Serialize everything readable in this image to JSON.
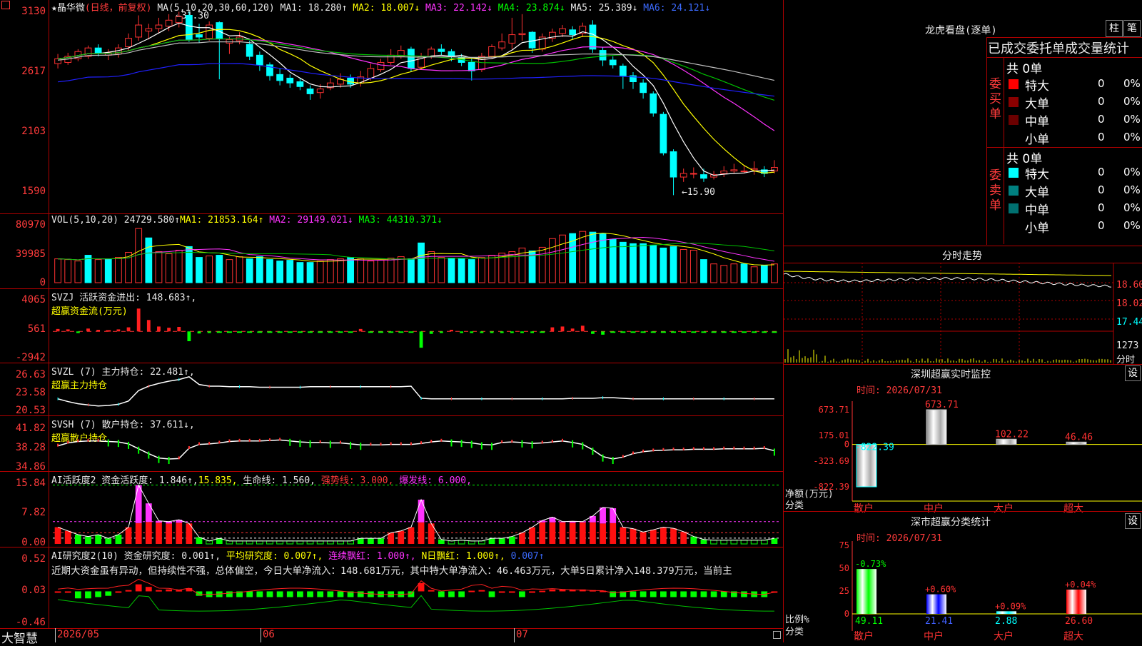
{
  "kline": {
    "title_star": "★晶华微",
    "title_mode": "(日线，前复权)",
    "ma_prefix": "MA(5,10,20,30,60,120)",
    "ma1": "MA1: 18.280↑",
    "ma2": "MA2: 18.007↓",
    "ma3": "MA3: 22.142↓",
    "ma4": "MA4: 23.874↓",
    "ma5": "MA5: 25.389↓",
    "ma6": "MA6: 24.121↓",
    "high_mark": "31.30",
    "low_mark": "←15.90",
    "y_labels": [
      "3130",
      "2617",
      "2103",
      "1590"
    ]
  },
  "vol": {
    "prefix": "VOL(5,10,20)",
    "value": "24729.580↑",
    "ma1": "MA1: 21853.164↑",
    "ma2": "MA2: 29149.021↓",
    "ma3": "MA3: 44310.371↓",
    "y_labels": [
      "80970",
      "39985",
      "0"
    ]
  },
  "svzj": {
    "line1": "SVZJ  活跃资金进出: 148.683↑,",
    "line2": "超赢资金流(万元)",
    "y_labels": [
      "4065",
      "561",
      "-2942"
    ]
  },
  "svzl": {
    "line1": "SVZL (7) 主力持仓: 22.481↑,",
    "line2": "超赢主力持仓",
    "y_labels": [
      "26.63",
      "23.58",
      "20.53"
    ]
  },
  "svsh": {
    "line1": "SVSH (7) 散户持仓: 37.611↓,",
    "line2": "超赢散户持仓",
    "y_labels": [
      "41.82",
      "38.28",
      "34.86"
    ]
  },
  "ai1": {
    "prefix": "AI活跃度2 资金活跃度: 1.846↑,",
    "v2": "15.835,",
    "life": "生命线: 1.560,",
    "strong": "强势线: 3.000,",
    "burst": "爆发线: 6.000,",
    "y_labels": [
      "15.84",
      "7.82",
      "0.00"
    ]
  },
  "ai2": {
    "prefix": "AI研究度2(10) 资金研究度: 0.001↑,",
    "avg": "平均研究度: 0.007↑,",
    "lianxu": "连续飘红: 1.000↑,",
    "nday": "N日飘红: 1.000↑,",
    "last": "0.007↑",
    "commentary": "近期大资金虽有异动，但持续性不强，总体偏空，今日大单净流入：148.681万元，其中特大单净流入：46.463万元，大单5日累计净入148.379万元，当前主",
    "y_labels": [
      "0.52",
      "0.03",
      "-0.46"
    ]
  },
  "bottom": {
    "logo": "大智慧",
    "dates": [
      "2026/05",
      "06",
      "07"
    ]
  },
  "lhb": {
    "title": "龙虎看盘(逐单)",
    "btn1": "柱",
    "btn2": "笔",
    "header": "已成交委托单成交量统计",
    "buy_total": "共 0单",
    "buy_side": "委买单",
    "sell_total": "共 0单",
    "sell_side": "委卖单",
    "buy_rows": [
      {
        "name": "特大",
        "num": "0",
        "pct": "0%",
        "color": "#ff0000"
      },
      {
        "name": "大单",
        "num": "0",
        "pct": "0%",
        "color": "#8b0000"
      },
      {
        "name": "中单",
        "num": "0",
        "pct": "0%",
        "color": "#6b0000"
      },
      {
        "name": "小单",
        "num": "0",
        "pct": "0%",
        "color": "#000000"
      }
    ],
    "sell_rows": [
      {
        "name": "特大",
        "num": "0",
        "pct": "0%",
        "color": "#00ffff"
      },
      {
        "name": "大单",
        "num": "0",
        "pct": "0%",
        "color": "#008080"
      },
      {
        "name": "中单",
        "num": "0",
        "pct": "0%",
        "color": "#007070"
      },
      {
        "name": "小单",
        "num": "0",
        "pct": "0%",
        "color": "#000000"
      }
    ]
  },
  "fenshi": {
    "title": "分时走势",
    "y_labels": [
      "18.60",
      "18.02",
      "17.44",
      "1273"
    ],
    "footer": "分时"
  },
  "szmon": {
    "title": "深圳超赢实时监控",
    "btn": "设",
    "time": "时间: 2026/07/31",
    "y_labels": [
      "673.71",
      "175.01",
      "0",
      "-323.69",
      "-822.39"
    ],
    "axis_title1": "净额(万元)",
    "axis_title2": "分类",
    "cats": [
      "散户",
      "中户",
      "大户",
      "超大"
    ],
    "values": [
      -822.39,
      673.71,
      102.22,
      46.46
    ],
    "value_labels": [
      "-822.39",
      "673.71",
      "102.22",
      "46.46"
    ]
  },
  "szcls": {
    "title": "深市超赢分类统计",
    "btn": "设",
    "time": "时间: 2026/07/31",
    "y_labels": [
      "75",
      "50",
      "25",
      "0"
    ],
    "axis_title1": "比例%",
    "axis_title2": "分类",
    "cats": [
      "散户",
      "中户",
      "大户",
      "超大"
    ],
    "values": [
      49.11,
      21.41,
      2.88,
      26.6
    ],
    "value_labels": [
      "49.11",
      "21.41",
      "2.88",
      "26.60"
    ],
    "changes": [
      "-0.73%",
      "+0.60%",
      "+0.09%",
      "+0.04%"
    ],
    "colors": [
      "#00ff00",
      "#0000ff",
      "#00ffff",
      "#ff0000"
    ]
  },
  "chart_data": [
    {
      "type": "candlestick",
      "name": "price-kline",
      "ylim": [
        15.0,
        31.8
      ],
      "candles": [
        [
          27.0,
          27.4,
          26.6,
          27.8
        ],
        [
          27.1,
          27.6,
          26.9,
          27.9
        ],
        [
          27.4,
          28.0,
          27.2,
          28.2
        ],
        [
          27.6,
          28.3,
          27.4,
          28.5
        ],
        [
          28.3,
          27.9,
          27.6,
          28.6
        ],
        [
          27.7,
          27.9,
          27.3,
          28.2
        ],
        [
          27.8,
          28.3,
          27.5,
          28.6
        ],
        [
          28.4,
          29.1,
          28.1,
          29.5
        ],
        [
          29.2,
          30.2,
          28.9,
          31.0
        ],
        [
          29.7,
          29.9,
          29.0,
          30.3
        ],
        [
          29.9,
          30.2,
          29.5,
          30.8
        ],
        [
          30.1,
          30.6,
          29.7,
          31.1
        ],
        [
          30.4,
          30.9,
          30.0,
          31.3
        ],
        [
          31.0,
          29.0,
          28.8,
          31.3
        ],
        [
          29.4,
          29.2,
          28.7,
          30.3
        ],
        [
          29.1,
          30.2,
          28.9,
          30.5
        ],
        [
          30.4,
          29.1,
          25.7,
          30.5
        ],
        [
          28.7,
          29.0,
          27.8,
          29.2
        ],
        [
          28.9,
          29.2,
          28.6,
          29.6
        ],
        [
          28.6,
          27.6,
          27.3,
          28.9
        ],
        [
          27.7,
          26.9,
          26.4,
          28.0
        ],
        [
          26.9,
          26.0,
          25.6,
          27.1
        ],
        [
          26.1,
          25.6,
          25.2,
          26.6
        ],
        [
          25.8,
          25.4,
          25.0,
          26.1
        ],
        [
          25.5,
          25.1,
          24.8,
          25.8
        ],
        [
          24.9,
          24.5,
          24.0,
          25.2
        ],
        [
          24.6,
          24.9,
          24.1,
          25.3
        ],
        [
          25.0,
          25.4,
          24.8,
          25.8
        ],
        [
          25.3,
          25.7,
          25.0,
          26.2
        ],
        [
          25.8,
          25.3,
          25.0,
          26.1
        ],
        [
          25.4,
          25.9,
          25.1,
          26.4
        ],
        [
          25.8,
          26.6,
          25.6,
          27.0
        ],
        [
          26.5,
          27.1,
          26.3,
          27.4
        ],
        [
          27.1,
          27.7,
          26.9,
          28.2
        ],
        [
          27.6,
          28.1,
          27.4,
          28.5
        ],
        [
          28.2,
          26.6,
          26.3,
          28.4
        ],
        [
          26.7,
          27.6,
          26.5,
          27.9
        ],
        [
          27.6,
          28.2,
          27.4,
          28.4
        ],
        [
          28.2,
          28.0,
          27.7,
          28.6
        ],
        [
          28.0,
          27.6,
          27.2,
          28.2
        ],
        [
          27.5,
          27.1,
          26.8,
          27.8
        ],
        [
          27.1,
          26.4,
          25.6,
          27.4
        ],
        [
          26.5,
          27.6,
          26.3,
          27.9
        ],
        [
          27.6,
          28.4,
          27.4,
          28.6
        ],
        [
          28.3,
          28.8,
          28.1,
          29.5
        ],
        [
          28.7,
          29.4,
          28.2,
          30.8
        ],
        [
          29.4,
          29.5,
          28.9,
          31.1
        ],
        [
          29.6,
          28.3,
          27.9,
          29.7
        ],
        [
          28.2,
          29.2,
          28.0,
          29.5
        ],
        [
          29.1,
          29.6,
          28.8,
          29.9
        ],
        [
          29.5,
          29.9,
          29.2,
          30.2
        ],
        [
          29.8,
          29.4,
          29.0,
          30.1
        ],
        [
          29.5,
          30.1,
          29.2,
          30.4
        ],
        [
          30.2,
          28.2,
          27.9,
          30.6
        ],
        [
          28.1,
          27.3,
          26.8,
          28.4
        ],
        [
          27.3,
          26.9,
          26.6,
          27.6
        ],
        [
          26.8,
          26.0,
          24.9,
          27.0
        ],
        [
          26.0,
          25.5,
          24.9,
          26.3
        ],
        [
          25.4,
          24.6,
          24.1,
          25.7
        ],
        [
          24.5,
          22.9,
          22.6,
          24.7
        ],
        [
          22.8,
          19.6,
          19.4,
          23.0
        ],
        [
          19.7,
          17.6,
          16.1,
          19.9
        ],
        [
          17.6,
          17.9,
          17.2,
          18.3
        ],
        [
          17.9,
          17.9,
          17.5,
          18.4
        ],
        [
          17.8,
          17.5,
          17.2,
          18.3
        ],
        [
          17.6,
          17.8,
          17.4,
          18.1
        ],
        [
          17.9,
          18.1,
          17.6,
          18.5
        ],
        [
          18.1,
          18.2,
          17.9,
          18.7
        ],
        [
          18.1,
          18.1,
          17.9,
          18.6
        ],
        [
          18.2,
          18.3,
          17.8,
          18.9
        ],
        [
          18.2,
          17.9,
          17.6,
          18.5
        ],
        [
          18.1,
          18.4,
          17.9,
          19.0
        ]
      ]
    },
    {
      "type": "bar",
      "name": "volume",
      "ylim": [
        0,
        85000
      ],
      "values": [
        33000,
        32000,
        30000,
        38000,
        32000,
        33000,
        35000,
        42000,
        75000,
        62000,
        43000,
        40000,
        45000,
        50000,
        35000,
        37000,
        38000,
        32000,
        36000,
        33000,
        36000,
        32000,
        30000,
        31000,
        28000,
        28000,
        30000,
        32000,
        33000,
        35000,
        33000,
        30000,
        31000,
        34000,
        36000,
        33000,
        55000,
        43000,
        35000,
        34000,
        33000,
        32000,
        35000,
        38000,
        41000,
        43000,
        48000,
        44000,
        49000,
        61000,
        66000,
        68000,
        71000,
        70000,
        68000,
        60000,
        56000,
        54000,
        54000,
        52000,
        48000,
        50000,
        46000,
        45000,
        32000,
        26000,
        24000,
        26000,
        26000,
        22000,
        24000,
        26000
      ],
      "up": [
        1,
        1,
        1,
        0,
        1,
        0,
        1,
        1,
        1,
        0,
        1,
        1,
        1,
        0,
        0,
        1,
        0,
        1,
        1,
        0,
        0,
        0,
        0,
        0,
        0,
        0,
        1,
        1,
        1,
        0,
        1,
        1,
        1,
        1,
        1,
        0,
        0,
        1,
        1,
        0,
        0,
        0,
        1,
        1,
        1,
        1,
        1,
        0,
        1,
        1,
        1,
        0,
        1,
        0,
        0,
        0,
        0,
        0,
        0,
        0,
        0,
        0,
        1,
        1,
        0,
        1,
        1,
        1,
        0,
        1,
        0,
        1
      ]
    },
    {
      "type": "bar",
      "name": "svzj-fund-flow",
      "ylim": [
        -3300,
        4400
      ],
      "values": [
        300,
        250,
        -200,
        350,
        200,
        150,
        250,
        500,
        2800,
        1400,
        600,
        450,
        550,
        -1200,
        -250,
        -200,
        -150,
        -150,
        -150,
        -150,
        -150,
        -150,
        -150,
        -150,
        -150,
        -150,
        -150,
        -150,
        -150,
        -150,
        300,
        -150,
        -150,
        -150,
        -150,
        -150,
        -2000,
        -300,
        -200,
        200,
        -200,
        -200,
        -200,
        -200,
        -200,
        -200,
        -200,
        -200,
        -150,
        500,
        600,
        350,
        700,
        -300,
        -400,
        -150,
        -150,
        -150,
        -150,
        -150,
        -150,
        -150,
        -150,
        -150,
        -150,
        -150,
        -150,
        -150,
        -150,
        -150,
        -150,
        -150
      ]
    },
    {
      "type": "line",
      "name": "svzl-main-holding",
      "ylim": [
        20.0,
        27.0
      ],
      "values": [
        22.5,
        22.0,
        21.6,
        21.4,
        21.2,
        21.3,
        21.5,
        22.1,
        24.0,
        24.8,
        25.3,
        25.7,
        26.0,
        26.5,
        25.1,
        24.8,
        24.8,
        24.7,
        24.7,
        24.7,
        24.6,
        24.6,
        24.6,
        24.6,
        24.6,
        24.7,
        24.7,
        24.7,
        24.7,
        24.7,
        24.7,
        24.7,
        24.7,
        24.7,
        24.7,
        24.8,
        22.6,
        22.5,
        22.5,
        22.5,
        22.5,
        22.5,
        22.5,
        22.5,
        22.5,
        22.5,
        22.5,
        22.5,
        22.5,
        22.5,
        22.5,
        22.6,
        22.6,
        22.6,
        22.7,
        22.7,
        22.6,
        22.5,
        22.5,
        22.5,
        22.5,
        22.5,
        22.5,
        22.5,
        22.5,
        22.5,
        22.5,
        22.5,
        22.5,
        22.5,
        22.5,
        22.5
      ]
    },
    {
      "type": "line",
      "name": "svsh-retail-holding",
      "ylim": [
        34.0,
        42.5
      ],
      "values": [
        38.6,
        39.2,
        39.5,
        39.6,
        39.6,
        39.5,
        39.4,
        39.0,
        38.0,
        37.0,
        36.1,
        35.9,
        36.0,
        38.1,
        38.9,
        39.0,
        39.2,
        39.5,
        39.6,
        39.6,
        39.6,
        39.7,
        39.8,
        39.6,
        39.4,
        39.3,
        39.3,
        39.2,
        39.2,
        39.0,
        38.8,
        38.8,
        38.8,
        38.9,
        38.9,
        38.9,
        39.1,
        39.4,
        39.6,
        39.5,
        39.4,
        39.2,
        38.9,
        38.8,
        39.3,
        39.4,
        39.3,
        39.1,
        39.2,
        39.4,
        39.6,
        39.3,
        38.9,
        37.8,
        36.4,
        35.9,
        36.3,
        37.0,
        37.4,
        37.6,
        37.7,
        37.8,
        37.8,
        37.9,
        37.9,
        37.9,
        38.0,
        38.0,
        38.0,
        38.0,
        38.1,
        37.6
      ]
    },
    {
      "type": "bar",
      "name": "ai-activity",
      "ylim": [
        0,
        16.5
      ],
      "values": [
        4.5,
        3.5,
        2.5,
        2.0,
        2.5,
        1.5,
        2.5,
        4.5,
        15.8,
        10.9,
        6.2,
        6.0,
        6.5,
        5.5,
        1.8,
        0.8,
        1.5,
        0.8,
        0.8,
        0.8,
        0.8,
        0.8,
        0.8,
        0.8,
        0.8,
        0.8,
        0.8,
        0.8,
        0.8,
        0.8,
        1.5,
        1.5,
        1.5,
        3.0,
        3.5,
        4.5,
        11.9,
        5.5,
        1.2,
        0.8,
        1.0,
        0.8,
        0.8,
        1.5,
        1.5,
        2.0,
        3.0,
        4.5,
        6.3,
        7.2,
        6.0,
        6.1,
        6.0,
        7.5,
        9.8,
        9.6,
        4.5,
        4.1,
        3.2,
        3.8,
        4.5,
        4.2,
        3.3,
        2.0,
        1.2,
        1.0,
        1.0,
        1.0,
        1.0,
        1.0,
        1.0,
        1.5
      ],
      "pink_top": [
        0,
        0,
        0,
        0,
        0,
        0,
        0,
        0,
        10.2,
        5.0,
        0.5,
        0.5,
        0.8,
        0,
        0,
        0,
        0,
        0,
        0,
        0,
        0,
        0,
        0,
        0,
        0,
        0,
        0,
        0,
        0,
        0,
        0,
        0,
        0,
        0,
        0,
        0,
        6.1,
        0,
        0,
        0,
        0,
        0,
        0,
        0,
        0,
        0,
        0,
        0,
        0.5,
        1.4,
        0.2,
        0.4,
        0.2,
        1.7,
        4.3,
        4.0,
        0,
        0,
        0,
        0,
        0,
        0,
        0,
        0,
        0,
        0,
        0,
        0,
        0,
        0,
        0,
        0
      ]
    },
    {
      "type": "bar",
      "name": "ai-research",
      "ylim": [
        -0.48,
        0.55
      ],
      "values": [
        0.03,
        0.03,
        -0.08,
        -0.08,
        -0.06,
        -0.04,
        0.03,
        0.05,
        0.14,
        0.1,
        0.05,
        0.06,
        0.05,
        0.08,
        -0.04,
        -0.06,
        -0.06,
        -0.06,
        -0.06,
        -0.06,
        -0.06,
        -0.06,
        -0.06,
        -0.06,
        -0.06,
        -0.06,
        -0.06,
        -0.06,
        -0.06,
        -0.06,
        -0.06,
        -0.06,
        -0.06,
        -0.06,
        -0.06,
        -0.06,
        0.16,
        0.05,
        -0.06,
        -0.06,
        -0.06,
        0.04,
        0.05,
        -0.06,
        0.03,
        0.03,
        -0.06,
        0.03,
        0.04,
        0.06,
        0.06,
        0.06,
        0.06,
        0.05,
        0.04,
        -0.06,
        -0.06,
        -0.06,
        -0.06,
        -0.06,
        -0.06,
        -0.06,
        -0.06,
        -0.06,
        -0.06,
        -0.06,
        -0.06,
        -0.06,
        -0.06,
        -0.06,
        -0.06,
        0.03
      ]
    },
    {
      "type": "bar",
      "name": "shenzhen-realtime-net",
      "categories": [
        "散户",
        "中户",
        "大户",
        "超大"
      ],
      "values": [
        -822.39,
        673.71,
        102.22,
        46.46
      ]
    },
    {
      "type": "bar",
      "name": "shenzhen-class-ratio",
      "categories": [
        "散户",
        "中户",
        "大户",
        "超大"
      ],
      "values": [
        49.11,
        21.41,
        2.88,
        26.6
      ]
    }
  ]
}
